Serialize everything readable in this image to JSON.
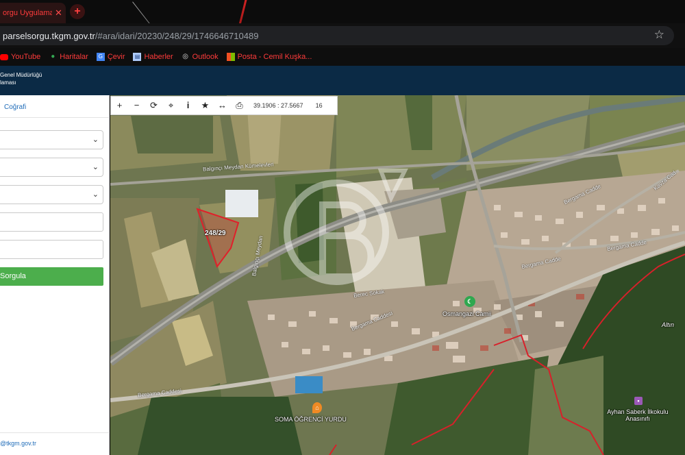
{
  "browser": {
    "tab_title": "orgu Uygulaması",
    "tab_close": "✕",
    "new_tab": "+",
    "url_host": "parselsorgu.tkgm.gov.tr",
    "url_path": "/#ara/idari/20230/248/29/1746646710489",
    "bookmark_star": "☆",
    "bookmarks": [
      {
        "label": "YouTube",
        "icon": "youtube-icon"
      },
      {
        "label": "Haritalar",
        "icon": "maps-pin-icon"
      },
      {
        "label": "Çevir",
        "icon": "translate-icon"
      },
      {
        "label": "Haberler",
        "icon": "news-icon"
      },
      {
        "label": "Outlook",
        "icon": "globe-icon"
      },
      {
        "label": "Posta - Cemil Kuşka...",
        "icon": "mail-icon"
      }
    ]
  },
  "site_header": {
    "line1": "Genel Müdürlüğü",
    "line2": "laması"
  },
  "left_panel": {
    "tab_label": "Coğrafi",
    "query_button": "Sorgula",
    "footer_email": "@tkgm.gov.tr"
  },
  "toolbar": {
    "buttons": [
      {
        "name": "zoom-in",
        "glyph": "+"
      },
      {
        "name": "zoom-out",
        "glyph": "−"
      },
      {
        "name": "refresh",
        "glyph": "⟳"
      },
      {
        "name": "locate",
        "glyph": "⌖"
      },
      {
        "name": "info",
        "glyph": "i"
      },
      {
        "name": "favorite",
        "glyph": "★"
      },
      {
        "name": "measure",
        "glyph": "↔"
      },
      {
        "name": "print",
        "glyph": "⎙"
      }
    ],
    "coordinates": "39.1906 : 27.5667",
    "zoom_level": "16"
  },
  "map": {
    "parcel_label": "248/29",
    "roads": [
      "Balgınçı Meydan Kümelevleri",
      "Bergama Caddesi",
      "Bergama Caddesi",
      "Bergama Cadde",
      "Bergama Cadde",
      "Balgınçı Meydan",
      "Berec Sokak",
      "Kavza Cad",
      "Bergama Cadde"
    ],
    "pois": {
      "mosque": "Osmangazi Camii",
      "dorm": "SOMA ÖĞRENCİ YURDU",
      "school": "Ayhan Saberk İlkokulu Anasınıfı",
      "area": "Altın"
    },
    "watermark": "GB",
    "colors": {
      "parcel": "#e0202a",
      "boundary": "#d8202a",
      "mosque_pin": "#2fa84f",
      "dorm_pin": "#f08a24",
      "school_pin": "#9b59b6"
    }
  }
}
